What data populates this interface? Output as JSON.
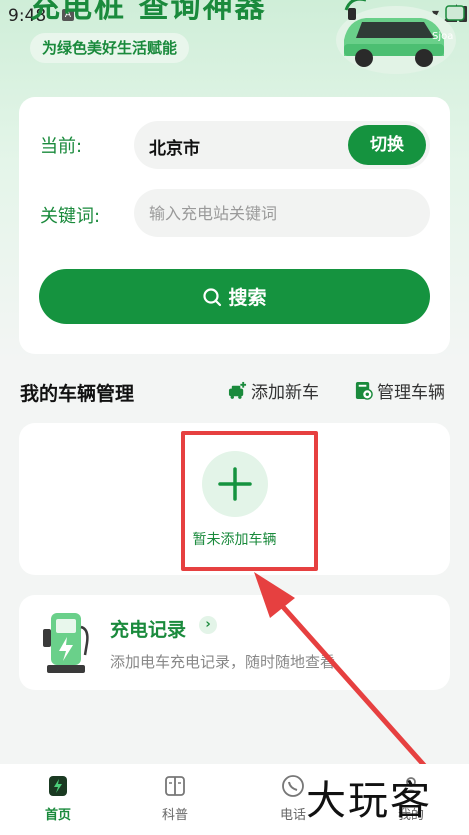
{
  "status_bar": {
    "time": "9:48",
    "notif_icon": "A"
  },
  "hero": {
    "title": "充电桩 查询神器",
    "slogan": "为绿色美好生活赋能",
    "car_watermark": "Sjoa"
  },
  "search": {
    "current_label": "当前:",
    "city": "北京市",
    "switch_label": "切换",
    "keyword_label": "关键词:",
    "keyword_placeholder": "输入充电站关键词",
    "keyword_value": "",
    "search_label": "搜索"
  },
  "vehicles": {
    "section_title": "我的车辆管理",
    "add_new_label": "添加新车",
    "manage_label": "管理车辆",
    "empty_text": "暂未添加车辆"
  },
  "record": {
    "title": "充电记录",
    "chevron": "›",
    "description": "添加电车充电记录，随时随地查看"
  },
  "tabs": [
    {
      "label": "首页",
      "icon": "home-charge-icon",
      "active": true
    },
    {
      "label": "科普",
      "icon": "book-icon",
      "active": false
    },
    {
      "label": "电话",
      "icon": "phone-icon",
      "active": false
    },
    {
      "label": "我的",
      "icon": "profile-icon",
      "active": false
    }
  ],
  "overlay_watermark": "大玩客",
  "colors": {
    "primary_green": "#15933f",
    "text_green": "#1a8a3c",
    "annotation_red": "#e64040"
  }
}
